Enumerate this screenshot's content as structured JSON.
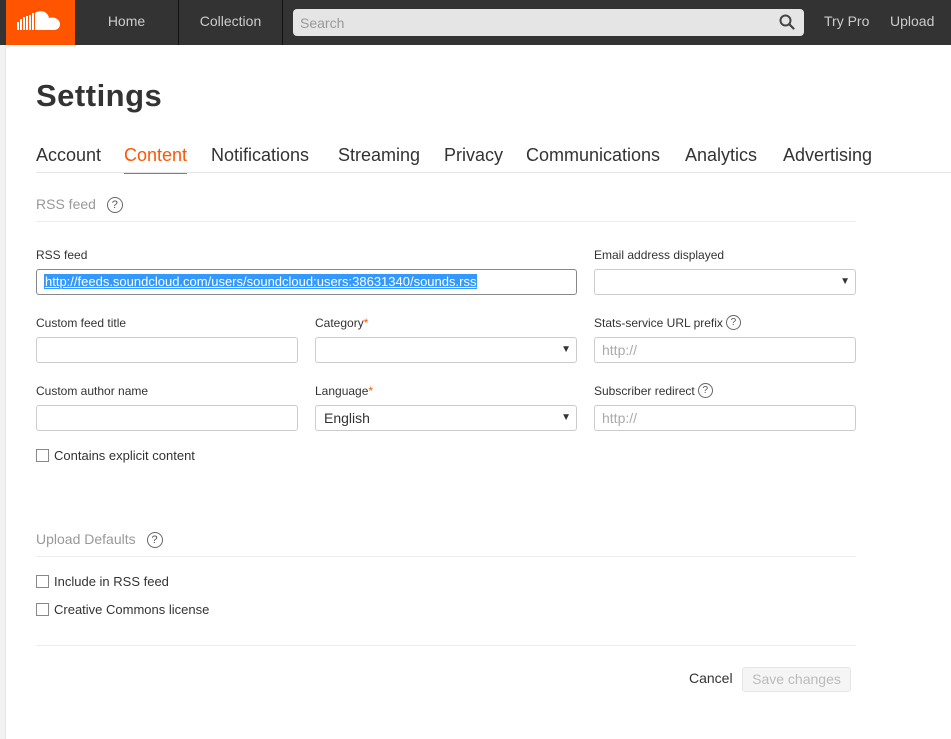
{
  "colors": {
    "accent": "#ff5500",
    "topbar": "#333333",
    "selection": "#3399ff"
  },
  "header": {
    "logo_icon": "soundcloud-logo-icon",
    "nav": {
      "home": "Home",
      "collection": "Collection"
    },
    "search": {
      "placeholder": "Search",
      "icon": "search-icon"
    },
    "try_pro": "Try Pro",
    "upload": "Upload"
  },
  "page": {
    "title": "Settings"
  },
  "tabs": [
    {
      "label": "Account",
      "active": false
    },
    {
      "label": "Content",
      "active": true
    },
    {
      "label": "Notifications",
      "active": false
    },
    {
      "label": "Streaming",
      "active": false
    },
    {
      "label": "Privacy",
      "active": false
    },
    {
      "label": "Communications",
      "active": false
    },
    {
      "label": "Analytics",
      "active": false
    },
    {
      "label": "Advertising",
      "active": false
    }
  ],
  "rss_section": {
    "title": "RSS feed",
    "help_glyph": "?",
    "rss_feed": {
      "label": "RSS feed",
      "value": "http://feeds.soundcloud.com/users/soundcloud:users:38631340/sounds.rss"
    },
    "email_displayed": {
      "label": "Email address displayed",
      "value": ""
    },
    "custom_feed_title": {
      "label": "Custom feed title",
      "value": ""
    },
    "category": {
      "label": "Category",
      "required_mark": "*",
      "value": ""
    },
    "stats_prefix": {
      "label": "Stats-service URL prefix",
      "placeholder": "http://"
    },
    "custom_author": {
      "label": "Custom author name",
      "value": ""
    },
    "language": {
      "label": "Language",
      "required_mark": "*",
      "value": "English"
    },
    "subscriber_redirect": {
      "label": "Subscriber redirect",
      "placeholder": "http://"
    },
    "explicit": {
      "label": "Contains explicit content",
      "checked": false
    }
  },
  "upload_section": {
    "title": "Upload Defaults",
    "include_rss": {
      "label": "Include in RSS feed",
      "checked": false
    },
    "creative_commons": {
      "label": "Creative Commons license",
      "checked": false
    }
  },
  "footer": {
    "cancel": "Cancel",
    "save": "Save changes"
  },
  "dropdown_arrow": "▼"
}
